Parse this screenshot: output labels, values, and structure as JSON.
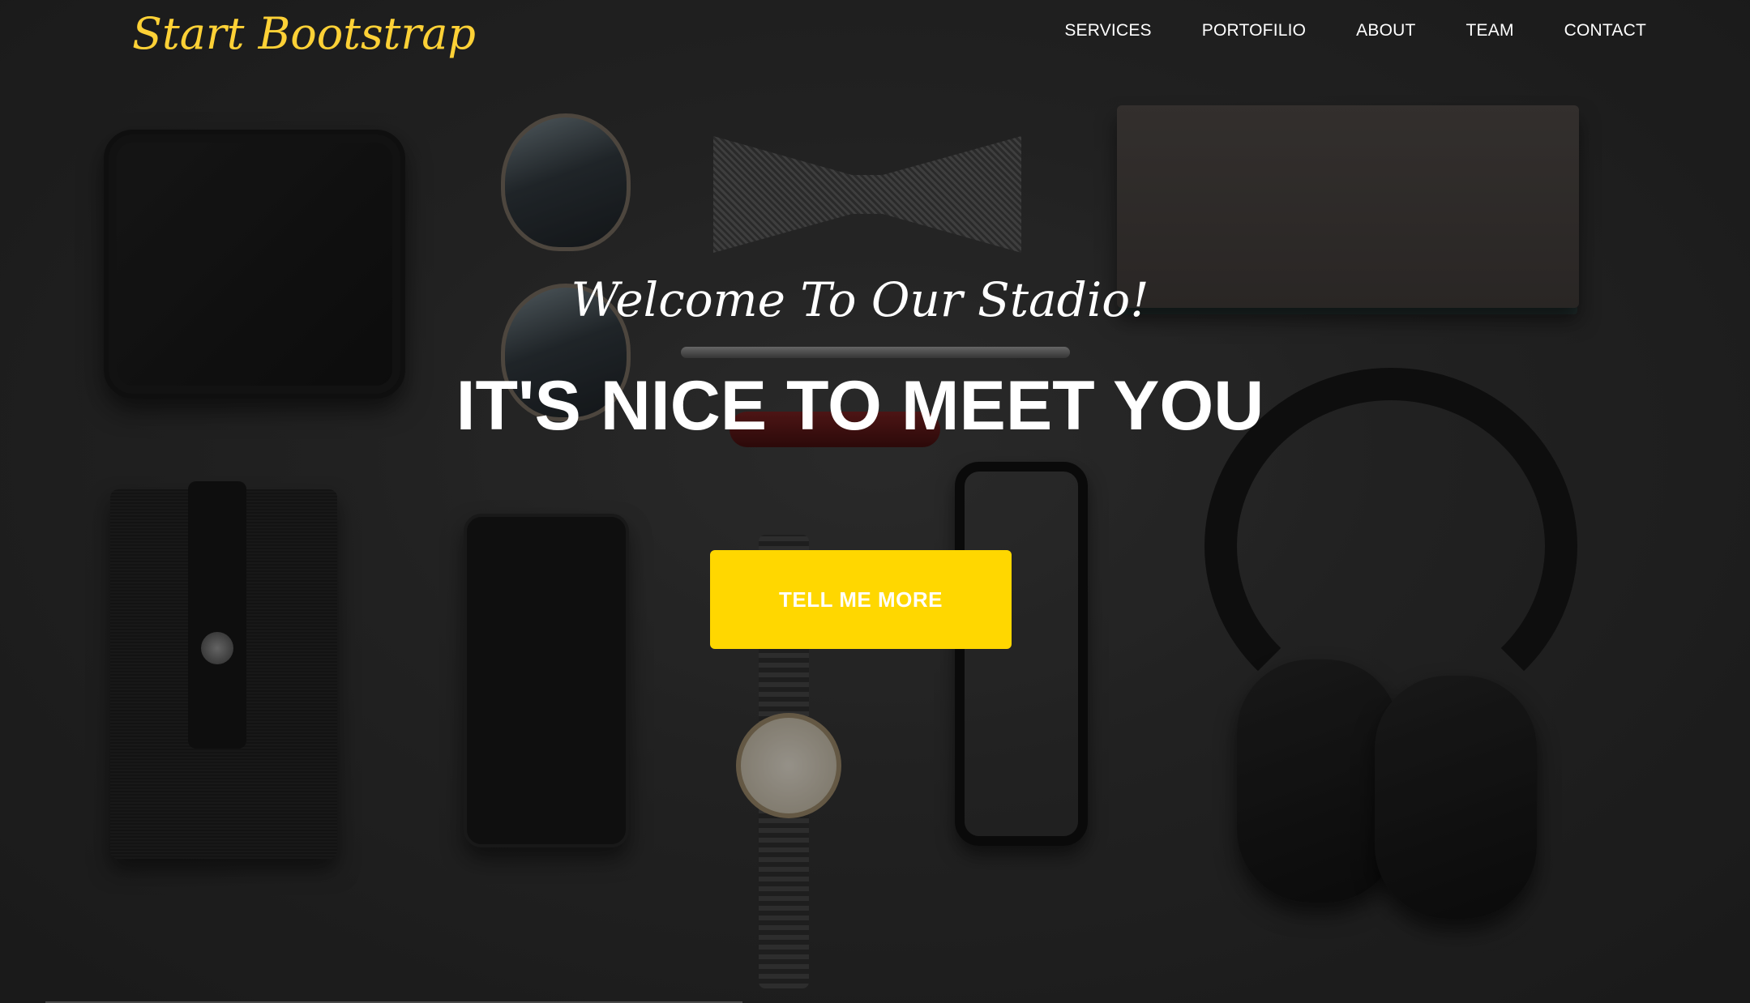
{
  "navbar": {
    "brand": "Start Bootstrap",
    "links": [
      "SERVICES",
      "PORTOFILIO",
      "ABOUT",
      "TEAM",
      "CONTACT"
    ]
  },
  "hero": {
    "lead": "Welcome To Our Stadio!",
    "heading": "IT'S NICE TO MEET YOU",
    "button_label": "TELL ME MORE"
  },
  "colors": {
    "brand": "#fed136",
    "button_bg": "#ffd700",
    "text": "#ffffff",
    "background": "#2e2e2e"
  }
}
